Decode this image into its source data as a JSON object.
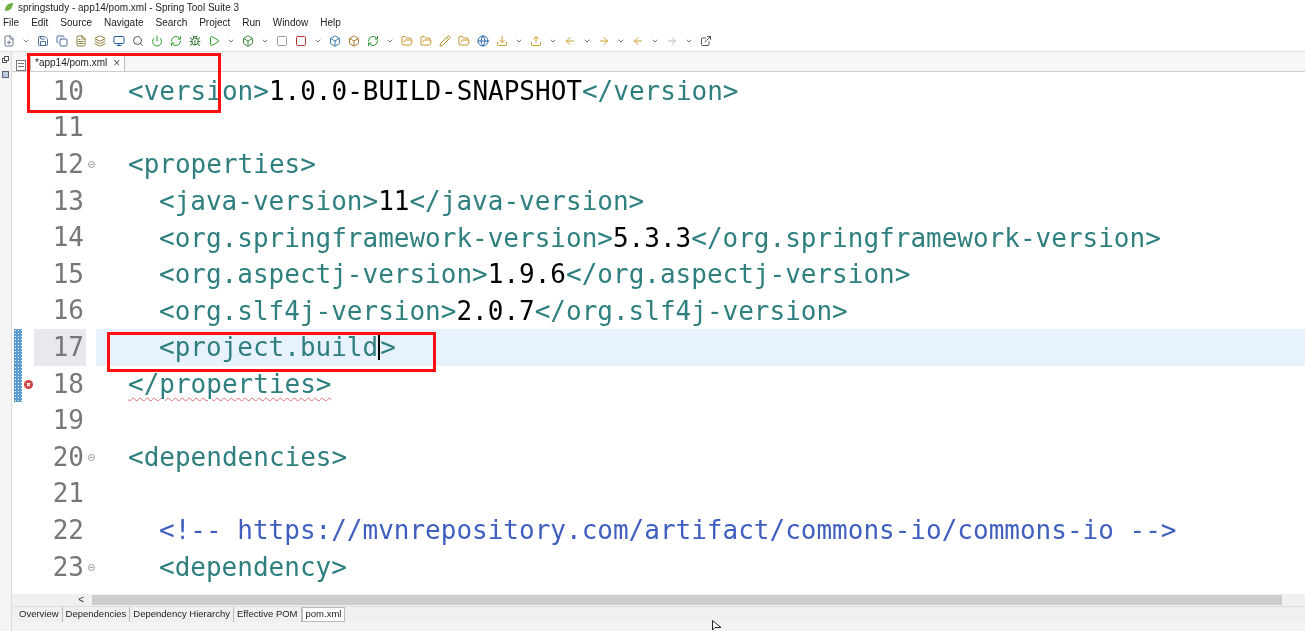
{
  "window": {
    "title": "springstudy - app14/pom.xml - Spring Tool Suite 3"
  },
  "menu": [
    "File",
    "Edit",
    "Source",
    "Navigate",
    "Search",
    "Project",
    "Run",
    "Window",
    "Help"
  ],
  "editor_tab": {
    "label": "*app14/pom.xml",
    "close": "×"
  },
  "lines": [
    {
      "number": "10",
      "indented": false,
      "current": false,
      "fold": false,
      "changed": false,
      "error": false,
      "segments": [
        {
          "kind": "tag",
          "text": "<version>"
        },
        {
          "kind": "text",
          "text": "1.0.0-BUILD-SNAPSHOT"
        },
        {
          "kind": "tag",
          "text": "</version>"
        }
      ]
    },
    {
      "number": "11",
      "indented": false,
      "current": false,
      "fold": false,
      "changed": false,
      "error": false
    },
    {
      "number": "12",
      "indented": false,
      "current": false,
      "fold": true,
      "changed": false,
      "error": false,
      "segments": [
        {
          "kind": "tag",
          "text": "<properties>"
        }
      ]
    },
    {
      "number": "13",
      "indented": true,
      "current": false,
      "fold": false,
      "changed": false,
      "error": false,
      "segments": [
        {
          "kind": "tag",
          "text": "<java-version>"
        },
        {
          "kind": "text",
          "text": "11"
        },
        {
          "kind": "tag",
          "text": "</java-version>"
        }
      ]
    },
    {
      "number": "14",
      "indented": true,
      "current": false,
      "fold": false,
      "changed": false,
      "error": false,
      "segments": [
        {
          "kind": "tag",
          "text": "<org.springframework-version>"
        },
        {
          "kind": "text",
          "text": "5.3.3"
        },
        {
          "kind": "tag",
          "text": "</org.springframework-version>"
        }
      ]
    },
    {
      "number": "15",
      "indented": true,
      "current": false,
      "fold": false,
      "changed": false,
      "error": false,
      "segments": [
        {
          "kind": "tag",
          "text": "<org.aspectj-version>"
        },
        {
          "kind": "text",
          "text": "1.9.6"
        },
        {
          "kind": "tag",
          "text": "</org.aspectj-version>"
        }
      ]
    },
    {
      "number": "16",
      "indented": true,
      "current": false,
      "fold": false,
      "changed": false,
      "error": false,
      "segments": [
        {
          "kind": "tag",
          "text": "<org.slf4j-version>"
        },
        {
          "kind": "text",
          "text": "2.0.7"
        },
        {
          "kind": "tag",
          "text": "</org.slf4j-version>"
        }
      ]
    },
    {
      "number": "17",
      "indented": true,
      "current": true,
      "fold": false,
      "changed": true,
      "error": false,
      "segments": [
        {
          "kind": "tag",
          "text": "<project.build"
        },
        {
          "kind": "cursor"
        },
        {
          "kind": "tag",
          "text": ">"
        }
      ]
    },
    {
      "number": "18",
      "indented": false,
      "current": false,
      "fold": false,
      "changed": true,
      "error": true,
      "segments": [
        {
          "kind": "error_tag",
          "text": "</properties>"
        }
      ]
    },
    {
      "number": "19",
      "indented": false,
      "current": false,
      "fold": false,
      "changed": false,
      "error": false
    },
    {
      "number": "20",
      "indented": false,
      "current": false,
      "fold": true,
      "changed": false,
      "error": false,
      "segments": [
        {
          "kind": "tag",
          "text": "<dependencies>"
        }
      ]
    },
    {
      "number": "21",
      "indented": false,
      "current": false,
      "fold": false,
      "changed": false,
      "error": false
    },
    {
      "number": "22",
      "indented": true,
      "current": false,
      "fold": false,
      "changed": false,
      "error": false,
      "segments": [
        {
          "kind": "comment",
          "text": "<!-- https://mvnrepository.com/artifact/commons-io/commons-io -->"
        }
      ]
    },
    {
      "number": "23",
      "indented": true,
      "current": false,
      "fold": true,
      "changed": false,
      "error": false,
      "segments": [
        {
          "kind": "tag",
          "text": "<dependency>"
        }
      ]
    }
  ],
  "bottom_tabs": [
    {
      "label": "Overview",
      "selected": false
    },
    {
      "label": "Dependencies",
      "selected": false
    },
    {
      "label": "Dependency Hierarchy",
      "selected": false
    },
    {
      "label": "Effective POM",
      "selected": false
    },
    {
      "label": "pom.xml",
      "selected": true
    }
  ],
  "scroll_left": "<"
}
